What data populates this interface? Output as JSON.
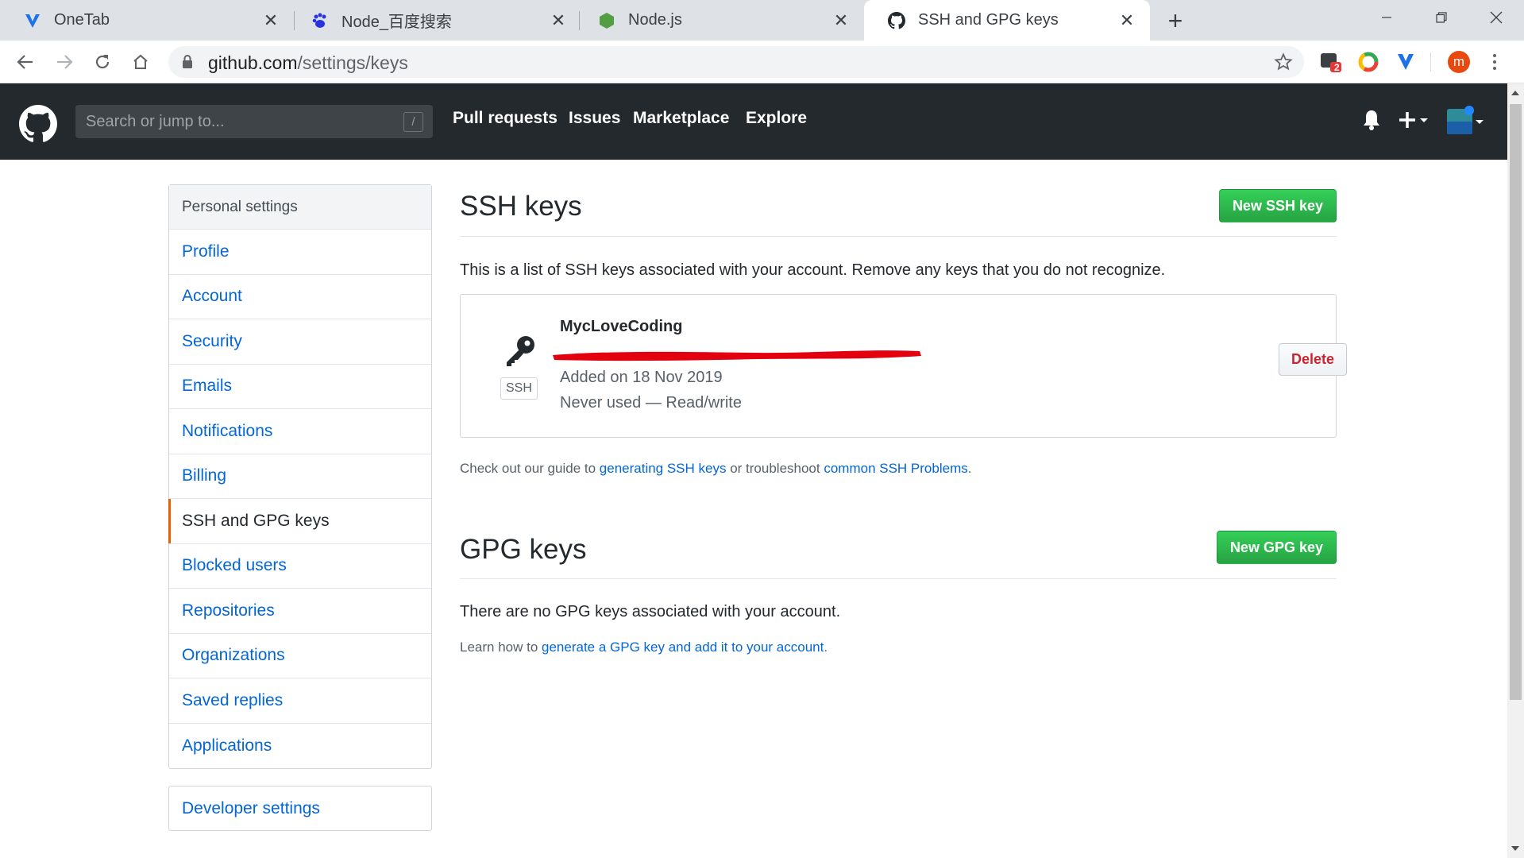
{
  "browser": {
    "tabs": [
      {
        "title": "OneTab",
        "icon": "onetab-icon",
        "active": false
      },
      {
        "title": "Node_百度搜索",
        "icon": "baidu-paw-icon",
        "active": false
      },
      {
        "title": "Node.js",
        "icon": "nodejs-hexagon-icon",
        "active": false
      },
      {
        "title": "SSH and GPG keys",
        "icon": "github-octocat-icon",
        "active": true
      }
    ],
    "url_host": "github.com",
    "url_path": "/settings/keys",
    "extension_badge": "2",
    "profile_initial": "m"
  },
  "header": {
    "search_placeholder": "Search or jump to...",
    "search_shortcut": "/",
    "nav": [
      "Pull requests",
      "Issues",
      "Marketplace",
      "Explore"
    ]
  },
  "sidebar": {
    "heading": "Personal settings",
    "items": [
      {
        "label": "Profile",
        "selected": false
      },
      {
        "label": "Account",
        "selected": false
      },
      {
        "label": "Security",
        "selected": false
      },
      {
        "label": "Emails",
        "selected": false
      },
      {
        "label": "Notifications",
        "selected": false
      },
      {
        "label": "Billing",
        "selected": false
      },
      {
        "label": "SSH and GPG keys",
        "selected": true
      },
      {
        "label": "Blocked users",
        "selected": false
      },
      {
        "label": "Repositories",
        "selected": false
      },
      {
        "label": "Organizations",
        "selected": false
      },
      {
        "label": "Saved replies",
        "selected": false
      },
      {
        "label": "Applications",
        "selected": false
      }
    ],
    "developer_settings": "Developer settings"
  },
  "ssh": {
    "title": "SSH keys",
    "new_button": "New SSH key",
    "description": "This is a list of SSH keys associated with your account. Remove any keys that you do not recognize.",
    "key": {
      "badge": "SSH",
      "title": "MycLoveCoding",
      "added": "Added on 18 Nov 2019",
      "usage": "Never used — Read/write",
      "delete_label": "Delete"
    },
    "guide_prefix": "Check out our guide to ",
    "guide_link1": "generating SSH keys",
    "guide_middle": " or troubleshoot ",
    "guide_link2": "common SSH Problems",
    "guide_suffix": "."
  },
  "gpg": {
    "title": "GPG keys",
    "new_button": "New GPG key",
    "empty": "There are no GPG keys associated with your account.",
    "learn_prefix": "Learn how to ",
    "learn_link": "generate a GPG key and add it to your account",
    "learn_suffix": "."
  },
  "colors": {
    "header_bg": "#24292e",
    "link": "#0366d6",
    "green": "#28a745",
    "danger": "#cb2431",
    "selected_marker": "#e36209"
  }
}
